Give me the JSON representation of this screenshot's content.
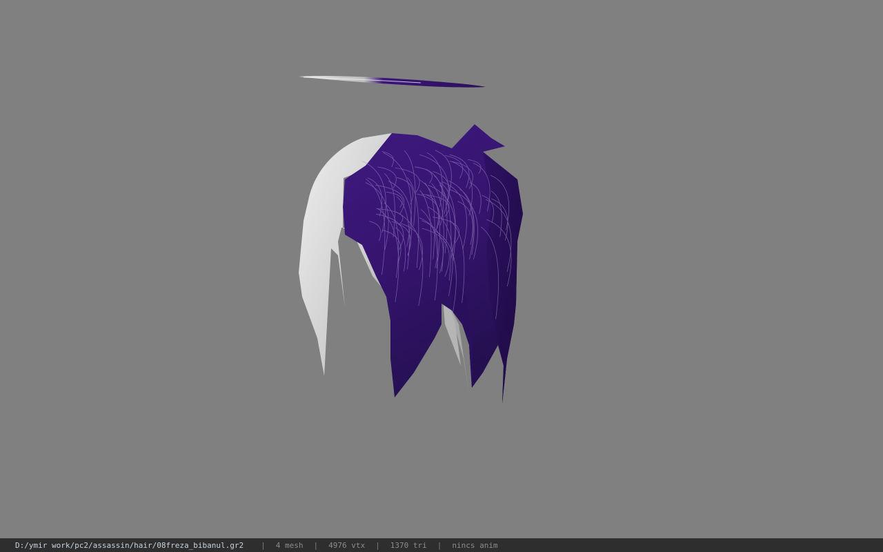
{
  "viewport": {
    "background_color": "#808080",
    "model": {
      "primary_color": "#3b1778",
      "secondary_color": "#d6d6d6"
    }
  },
  "status_bar": {
    "file_path": "D:/ymir work/pc2/assassin/hair/08freza_bibanul.gr2",
    "separator": "|",
    "mesh_count": "4 mesh",
    "vertex_count": "4976 vtx",
    "triangle_count": "1370 tri",
    "animation_status": "nincs anim"
  }
}
